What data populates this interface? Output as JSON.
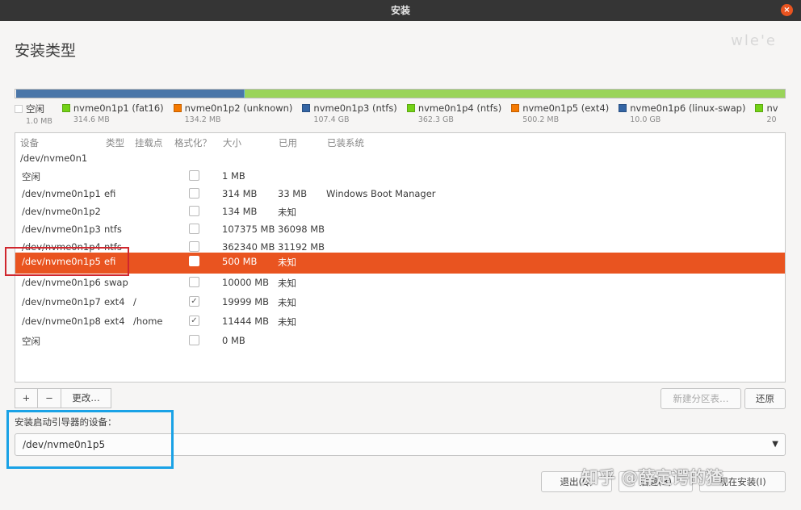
{
  "window": {
    "title": "安装",
    "close_glyph": "×"
  },
  "page": {
    "title": "安装类型"
  },
  "partition_bar": [
    {
      "color": "#ffffff",
      "frac": 0.001
    },
    {
      "color": "#4a76a8",
      "frac": 0.296
    },
    {
      "color": "#5fa9e0",
      "frac": 0.001
    },
    {
      "color": "#9ad45a",
      "frac": 0.702
    }
  ],
  "legend": [
    {
      "label": "空闲",
      "size": "1.0 MB",
      "color": "#ffffff"
    },
    {
      "label": "nvme0n1p1 (fat16)",
      "size": "314.6 MB",
      "color": "#73d216"
    },
    {
      "label": "nvme0n1p2 (unknown)",
      "size": "134.2 MB",
      "color": "#f57900"
    },
    {
      "label": "nvme0n1p3 (ntfs)",
      "size": "107.4 GB",
      "color": "#3465a4"
    },
    {
      "label": "nvme0n1p4 (ntfs)",
      "size": "362.3 GB",
      "color": "#73d216"
    },
    {
      "label": "nvme0n1p5 (ext4)",
      "size": "500.2 MB",
      "color": "#f57900"
    },
    {
      "label": "nvme0n1p6 (linux-swap)",
      "size": "10.0 GB",
      "color": "#3465a4"
    },
    {
      "label": "nv",
      "size": "20",
      "color": "#73d216"
    }
  ],
  "table": {
    "headers": {
      "device": "设备",
      "type": "类型",
      "mount": "挂载点",
      "format": "格式化？",
      "size": "大小",
      "used": "已用",
      "system": "已装系统"
    },
    "disk": "/dev/nvme0n1",
    "rows": [
      {
        "device": "空闲",
        "type": "",
        "mount": "",
        "format": false,
        "size": "1 MB",
        "used": "",
        "system": ""
      },
      {
        "device": "/dev/nvme0n1p1",
        "type": "efi",
        "mount": "",
        "format": false,
        "size": "314 MB",
        "used": "33 MB",
        "system": "Windows Boot Manager"
      },
      {
        "device": "/dev/nvme0n1p2",
        "type": "",
        "mount": "",
        "format": false,
        "size": "134 MB",
        "used": "未知",
        "system": ""
      },
      {
        "device": "/dev/nvme0n1p3",
        "type": "ntfs",
        "mount": "",
        "format": false,
        "size": "107375 MB",
        "used": "36098 MB",
        "system": ""
      },
      {
        "device": "/dev/nvme0n1p4",
        "type": "ntfs",
        "mount": "",
        "format": false,
        "size": "362340 MB",
        "used": "31192 MB",
        "system": ""
      },
      {
        "device": "/dev/nvme0n1p5",
        "type": "efi",
        "mount": "",
        "format": false,
        "size": "500 MB",
        "used": "未知",
        "system": "",
        "selected": true
      },
      {
        "device": "/dev/nvme0n1p6",
        "type": "swap",
        "mount": "",
        "format": false,
        "size": "10000 MB",
        "used": "未知",
        "system": ""
      },
      {
        "device": "/dev/nvme0n1p7",
        "type": "ext4",
        "mount": "/",
        "format": true,
        "size": "19999 MB",
        "used": "未知",
        "system": ""
      },
      {
        "device": "/dev/nvme0n1p8",
        "type": "ext4",
        "mount": "/home",
        "format": true,
        "size": "11444 MB",
        "used": "未知",
        "system": ""
      },
      {
        "device": "空闲",
        "type": "",
        "mount": "",
        "format": false,
        "size": "0 MB",
        "used": "",
        "system": ""
      }
    ]
  },
  "toolbar": {
    "add": "+",
    "remove": "−",
    "change": "更改…",
    "new_table": "新建分区表…",
    "revert": "还原"
  },
  "bootloader": {
    "label": "安装启动引导器的设备：",
    "value": "/dev/nvme0n1p5",
    "arrow": "▼"
  },
  "actions": {
    "quit": "退出(Q)",
    "back": "后退(B)",
    "install": "现在安装(I)"
  },
  "watermark": "知乎 @薛定谔的猹",
  "watermark_top": "wle'e"
}
